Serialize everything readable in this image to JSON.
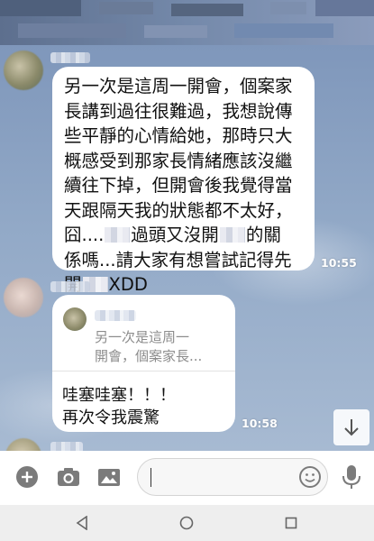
{
  "messages": [
    {
      "type": "incoming",
      "lines": [
        [
          "另一次是這周一開會，個案家"
        ],
        [
          "長講到過往很難過，我想說傳"
        ],
        [
          "些平靜的心情給她，那時只大"
        ],
        [
          "概感受到那家長情緒應該沒繼"
        ],
        [
          "續往下掉，但開會後我覺得當"
        ],
        [
          "天跟隔天我的狀態都不太好，"
        ],
        [
          "囧....",
          "過頭又沒開",
          "的關"
        ],
        [
          "係嗎...請大家有想嘗試記得先"
        ],
        [
          "開",
          "XDD"
        ]
      ],
      "time": "10:55"
    },
    {
      "type": "incoming",
      "quote": {
        "text_lines": [
          "另一次是這周一",
          "開會，個案家長..."
        ]
      },
      "lines": [
        "哇塞哇塞！！！",
        "再次令我震驚"
      ],
      "time": "10:58"
    }
  ],
  "icons": {
    "add": "plus-circle-icon",
    "camera": "camera-icon",
    "image": "image-icon",
    "emoji": "smiley-icon",
    "mic": "microphone-icon",
    "scroll": "arrow-down-icon",
    "nav_back": "triangle-back-icon",
    "nav_home": "circle-home-icon",
    "nav_recent": "square-recent-icon"
  },
  "colors": {
    "bubble": "#ffffff",
    "timestamp": "#ffffff",
    "icon": "#777777",
    "nav_icon": "#666666"
  }
}
